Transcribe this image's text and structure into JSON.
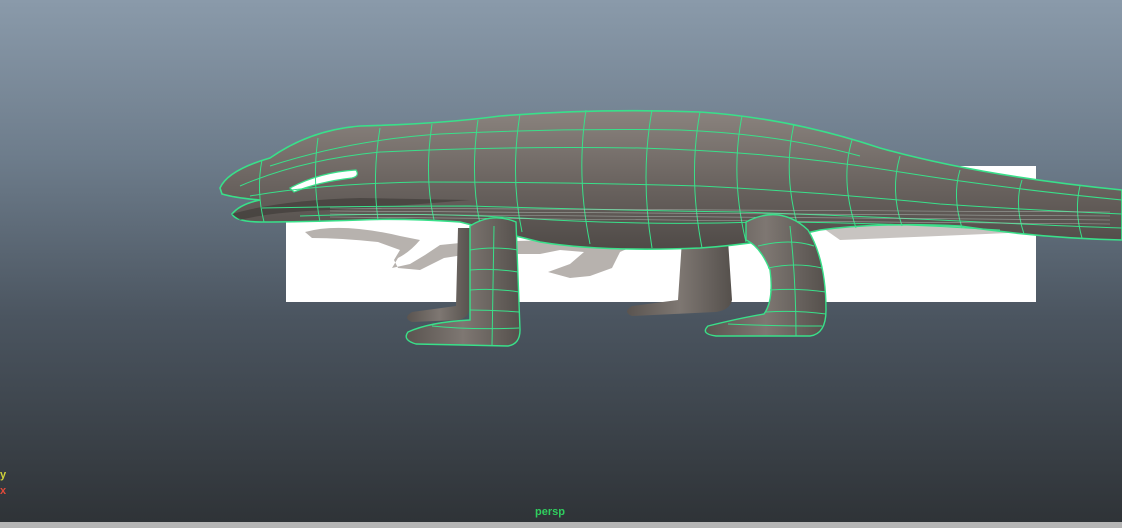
{
  "viewport": {
    "camera_label": "persp",
    "axis": {
      "y_label": "y",
      "x_label": "x"
    }
  },
  "colors": {
    "wireframe": "#39e08a",
    "mesh": "#6f6864",
    "image_plane": "#ffffff",
    "camera_label": "#2fcf5e",
    "axis_y": "#d0d23a",
    "axis_x": "#e04a3a"
  }
}
